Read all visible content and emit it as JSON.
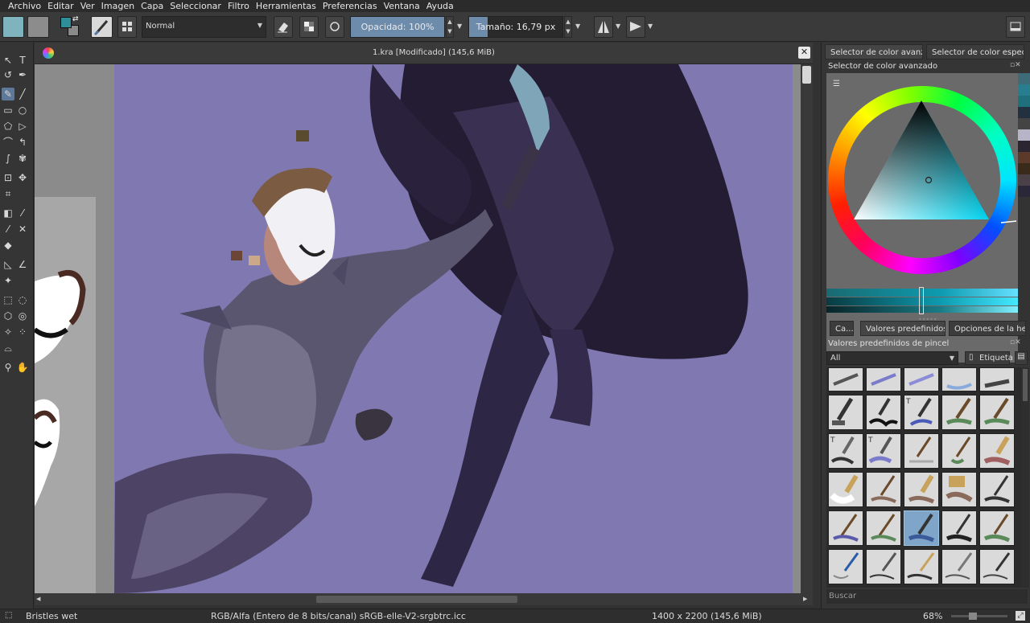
{
  "menu": [
    "Archivo",
    "Editar",
    "Ver",
    "Imagen",
    "Capa",
    "Seleccionar",
    "Filtro",
    "Herramientas",
    "Preferencias",
    "Ventana",
    "Ayuda"
  ],
  "toolbar": {
    "blend_mode": "Normal",
    "opacity_label": "Opacidad:  100%",
    "opacity_fraction": 1.0,
    "size_label": "Tamaño:  16,79 px",
    "size_fraction": 0.2
  },
  "document": {
    "title": "1.kra [Modificado]  (145,6 MiB)"
  },
  "dock": {
    "top_tabs": [
      "Selector de color avanz...",
      "Selector de color especif..."
    ],
    "color_panel_title": "Selector de color avanzado",
    "mid_tabs": [
      "Ca...",
      "Valores predefinidos...",
      "Opciones de la he..."
    ],
    "brush_panel_title": "Valores predefinidos de pincel",
    "filter_value": "All",
    "tag_label": "Etiqueta",
    "search_placeholder": "Buscar"
  },
  "status": {
    "brush_name": "Bristles wet",
    "color_space": "RGB/Alfa (Entero de 8 bits/canal)  sRGB-elle-V2-srgbtrc.icc",
    "dimensions": "1400 x 2200 (145,6 MiB)",
    "zoom": "68%"
  },
  "colors": {
    "accent": "#6d8bab",
    "canvas_bg": "#8078b1",
    "foreground": "#2e8f9b",
    "background": "#8a8a8a"
  }
}
